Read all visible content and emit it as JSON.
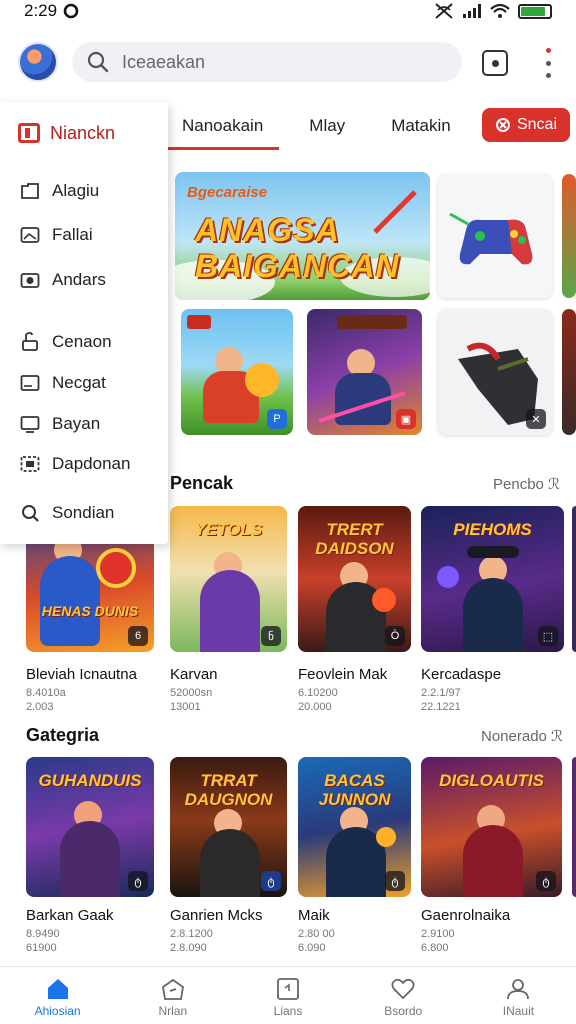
{
  "status_bar": {
    "time": "2:29",
    "battery_level": 0.85
  },
  "header": {
    "search_placeholder": "Iceaeakan"
  },
  "tabs": [
    {
      "label": "Nanoakain",
      "active": true
    },
    {
      "label": "Mlay",
      "active": false
    },
    {
      "label": "Matakin",
      "active": false
    }
  ],
  "cta": {
    "label": "Sncai"
  },
  "drawer": {
    "title": "Nianckn",
    "items": [
      {
        "label": "Alagiu",
        "icon": "folder-icon"
      },
      {
        "label": "Fallai",
        "icon": "image-icon"
      },
      {
        "label": "Andars",
        "icon": "camera-icon"
      },
      {
        "label": "Cenaon",
        "icon": "lock-icon"
      },
      {
        "label": "Necgat",
        "icon": "window-icon"
      },
      {
        "label": "Bayan",
        "icon": "monitor-icon"
      },
      {
        "label": "Dapdonan",
        "icon": "gallery-icon"
      },
      {
        "label": "Sondian",
        "icon": "search-icon"
      }
    ]
  },
  "hero": {
    "tag": "Bgecaraise",
    "title_line1": "ANAGSA",
    "title_line2": "BAIGANCAN"
  },
  "featured_cards": [
    {
      "badge": "P"
    },
    {
      "badge": "▣"
    },
    {
      "badge": "✕"
    }
  ],
  "sections": [
    {
      "title": "Pencak",
      "link": "Pencbo ℛ",
      "games": [
        {
          "thumb_title": "HENAS DUNIS",
          "name": "Bleviah Icnautna",
          "meta1": "8.4010a",
          "meta2": "2.003",
          "badge": "6"
        },
        {
          "thumb_title": "YETOLS",
          "name": "Karvan",
          "meta1": "52000sn",
          "meta2": "13001",
          "badge": "ნ"
        },
        {
          "thumb_title": "TRERT DAIDSON",
          "name": "Feovlein Mak",
          "meta1": "6.10200",
          "meta2": "20.000",
          "badge": "Ò"
        },
        {
          "thumb_title": "PIEHOMS",
          "name": "Kercadaspe",
          "meta1": "2.2.1/97",
          "meta2": "22.1221",
          "badge": "⬚"
        }
      ]
    },
    {
      "title": "Gategria",
      "link": "Nonerado ℛ",
      "games": [
        {
          "thumb_title": "GUHANDUIS",
          "name": "Barkan Gaak",
          "meta1": "8.9490",
          "meta2": "61900",
          "badge": "ტ"
        },
        {
          "thumb_title": "TRRAT DAUGNON",
          "name": "Ganrien Mcks",
          "meta1": "2.8.1200",
          "meta2": "2.8.090",
          "badge": "ტ"
        },
        {
          "thumb_title": "BACAS JUNNON",
          "name": "Maik",
          "meta1": "2.80 00",
          "meta2": "6.090",
          "badge": "ტ"
        },
        {
          "thumb_title": "DIGLOAUTIS",
          "name": "Gaenrolnaika",
          "meta1": "2.9100",
          "meta2": "6.800",
          "badge": "ტ"
        }
      ]
    }
  ],
  "bottom_nav": [
    {
      "label": "Ahiosian",
      "active": true,
      "icon": "home-icon"
    },
    {
      "label": "Nrlan",
      "active": false,
      "icon": "explore-icon"
    },
    {
      "label": "Lians",
      "active": false,
      "icon": "library-icon"
    },
    {
      "label": "Bsordo",
      "active": false,
      "icon": "heart-icon"
    },
    {
      "label": "INauit",
      "active": false,
      "icon": "profile-icon"
    }
  ],
  "colors": {
    "accent": "#d8322b",
    "nav_active": "#1a73e8"
  }
}
